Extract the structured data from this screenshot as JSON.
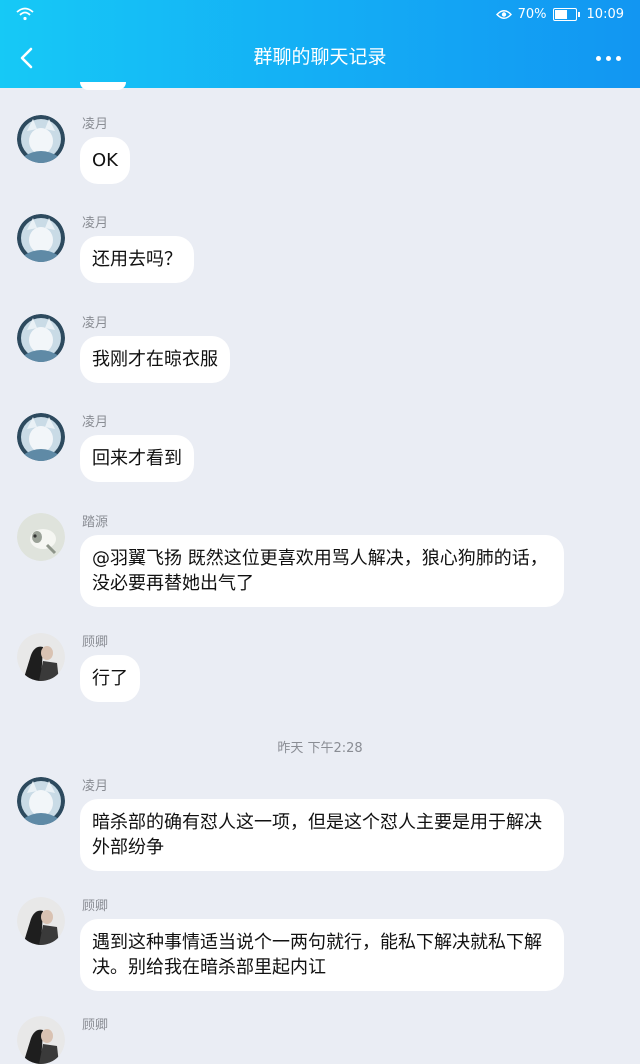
{
  "status_bar": {
    "battery": "70%",
    "battery_level": 0.7,
    "time": "10:09"
  },
  "header": {
    "title": "群聊的聊天记录"
  },
  "timestamp": "昨天 下午2:28",
  "messages": [
    {
      "sender": "凌月",
      "text": "OK"
    },
    {
      "sender": "凌月",
      "text": "还用去吗？"
    },
    {
      "sender": "凌月",
      "text": "我刚才在晾衣服"
    },
    {
      "sender": "凌月",
      "text": "回来才看到"
    },
    {
      "sender": "踏源",
      "text": "@羽翼飞扬 既然这位更喜欢用骂人解决，狼心狗肺的话，没必要再替她出气了"
    },
    {
      "sender": "顾卿",
      "text": "行了"
    },
    {
      "sender": "凌月",
      "text": "暗杀部的确有怼人这一项，但是这个怼人主要是用于解决外部纷争"
    },
    {
      "sender": "顾卿",
      "text": "遇到这种事情适当说个一两句就行，能私下解决就私下解决。别给我在暗杀部里起内讧"
    },
    {
      "sender": "顾卿",
      "text": ""
    }
  ],
  "icons": {
    "wifi": "wifi-icon",
    "eye": "eye-icon",
    "battery": "battery-icon",
    "back": "back-chevron-icon",
    "more": "more-dots-icon"
  }
}
